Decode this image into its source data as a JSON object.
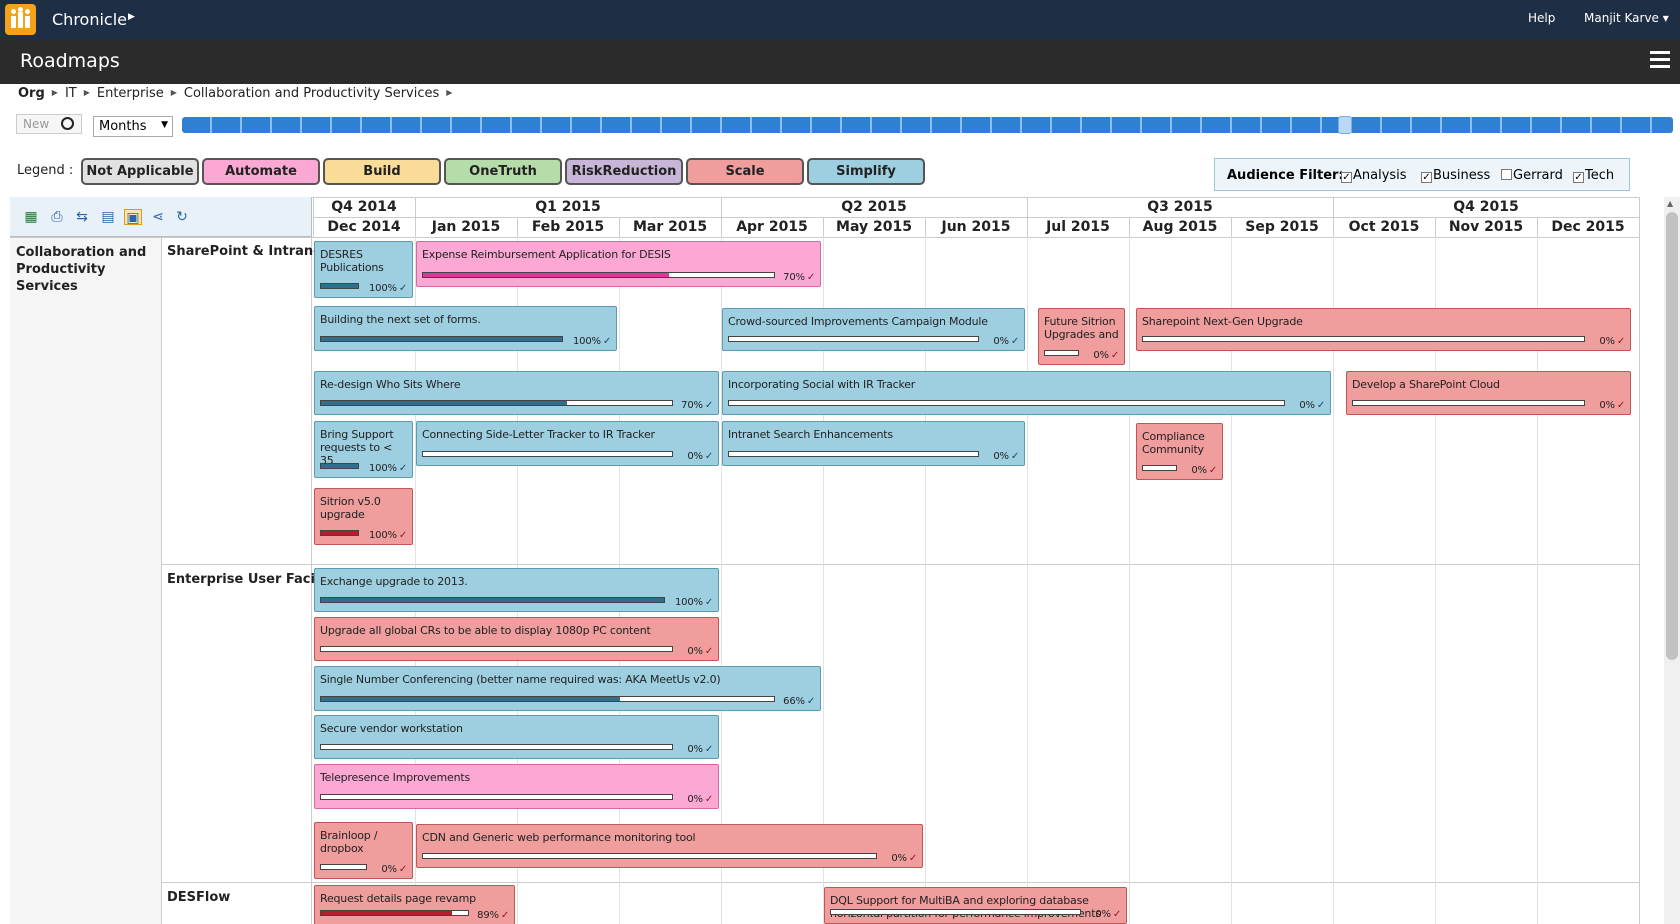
{
  "app": {
    "name": "Chronicle",
    "help": "Help",
    "user": "Manjit Karve ▾"
  },
  "page": {
    "title": "Roadmaps"
  },
  "breadcrumb": [
    "Org",
    "IT",
    "Enterprise",
    "Collaboration and Productivity Services"
  ],
  "toolbar": {
    "new_label": "New",
    "view_mode": "Months"
  },
  "timeline_slider": {
    "position_fraction": 0.79
  },
  "legend": {
    "label": "Legend :",
    "items": [
      {
        "label": "Not Applicable",
        "color": "#e2e2e2"
      },
      {
        "label": "Automate",
        "color": "#fba8d5"
      },
      {
        "label": "Build",
        "color": "#f8dc97"
      },
      {
        "label": "OneTruth",
        "color": "#b5dca9"
      },
      {
        "label": "RiskReduction",
        "color": "#c8b6d9"
      },
      {
        "label": "Scale",
        "color": "#ef9d9d"
      },
      {
        "label": "Simplify",
        "color": "#9dcfe1"
      }
    ]
  },
  "audience_filter": {
    "title": "Audience Filter:",
    "options": [
      {
        "label": "Analysis",
        "checked": true
      },
      {
        "label": "Business",
        "checked": true
      },
      {
        "label": "Gerrard",
        "checked": false
      },
      {
        "label": "Tech",
        "checked": true
      }
    ]
  },
  "grid_tools": [
    "excel-export-icon",
    "print-icon",
    "compare-icon",
    "table-view-icon",
    "roadmap-view-icon",
    "share-icon",
    "refresh-icon"
  ],
  "timeline": {
    "quarters": [
      "Q4 2014",
      "Q1 2015",
      "Q2 2015",
      "Q3 2015",
      "Q4 2015"
    ],
    "months": [
      "Dec 2014",
      "Jan 2015",
      "Feb 2015",
      "Mar 2015",
      "Apr 2015",
      "May 2015",
      "Jun 2015",
      "Jul 2015",
      "Aug 2015",
      "Sep 2015",
      "Oct 2015",
      "Nov 2015",
      "Dec 2015"
    ]
  },
  "org_unit": "Collaboration and Productivity Services",
  "categories": [
    "SharePoint & Intranet",
    "Enterprise User Facing",
    "DESFlow"
  ],
  "projects": [
    {
      "name": "DESRES Publications",
      "theme": "simplify",
      "progress": "100%",
      "start": "Dec 2014",
      "end": "Dec 2014"
    },
    {
      "name": "Expense Reimbursement Application for DESIS",
      "theme": "automate",
      "progress": "70%",
      "start": "Jan 2015",
      "end": "Apr 2015"
    },
    {
      "name": "Building the next set of forms.",
      "theme": "simplify",
      "progress": "100%",
      "start": "Dec 2014",
      "end": "Feb 2015"
    },
    {
      "name": "Crowd-sourced Improvements Campaign Module",
      "theme": "simplify",
      "progress": "0%",
      "start": "Apr 2015",
      "end": "Jun 2015"
    },
    {
      "name": "Future Sitrion Upgrades and",
      "theme": "scale",
      "progress": "0%",
      "start": "Jul 2015",
      "end": "Jul 2015"
    },
    {
      "name": "Sharepoint Next-Gen Upgrade",
      "theme": "scale",
      "progress": "0%",
      "start": "Aug 2015",
      "end": "Dec 2015"
    },
    {
      "name": "Re-design Who Sits Where",
      "theme": "simplify",
      "progress": "70%",
      "start": "Dec 2014",
      "end": "Mar 2015"
    },
    {
      "name": "Incorporating Social with IR Tracker",
      "theme": "simplify",
      "progress": "0%",
      "start": "Apr 2015",
      "end": "Sep 2015"
    },
    {
      "name": "Develop a SharePoint Cloud",
      "theme": "scale",
      "progress": "0%",
      "start": "Oct 2015",
      "end": "Dec 2015"
    },
    {
      "name": "Bring Support requests to < 35",
      "theme": "simplify",
      "progress": "100%",
      "start": "Dec 2014",
      "end": "Dec 2014"
    },
    {
      "name": "Connecting Side-Letter Tracker to IR Tracker",
      "theme": "simplify",
      "progress": "0%",
      "start": "Jan 2015",
      "end": "Mar 2015"
    },
    {
      "name": "Intranet Search Enhancements",
      "theme": "simplify",
      "progress": "0%",
      "start": "Apr 2015",
      "end": "Jun 2015"
    },
    {
      "name": "Compliance Community",
      "theme": "scale",
      "progress": "0%",
      "start": "Aug 2015",
      "end": "Aug 2015"
    },
    {
      "name": "Sitrion v5.0 upgrade",
      "theme": "scale",
      "progress": "100%",
      "start": "Dec 2014",
      "end": "Dec 2014"
    },
    {
      "name": "Exchange upgrade to 2013.",
      "theme": "simplify",
      "progress": "100%",
      "start": "Dec 2014",
      "end": "Mar 2015"
    },
    {
      "name": "Upgrade all global CRs to be able to display 1080p PC content",
      "theme": "scale",
      "progress": "0%",
      "start": "Dec 2014",
      "end": "Mar 2015"
    },
    {
      "name": "Single Number Conferencing (better name required was: AKA MeetUs v2.0)",
      "theme": "simplify",
      "progress": "66%",
      "start": "Dec 2014",
      "end": "Apr 2015"
    },
    {
      "name": "Secure vendor workstation",
      "theme": "simplify",
      "progress": "0%",
      "start": "Dec 2014",
      "end": "Mar 2015"
    },
    {
      "name": "Telepresence Improvements",
      "theme": "automate",
      "progress": "0%",
      "start": "Dec 2014",
      "end": "Mar 2015"
    },
    {
      "name": "Brainloop / dropbox",
      "theme": "scale",
      "progress": "0%",
      "start": "Dec 2014",
      "end": "Dec 2014"
    },
    {
      "name": "CDN and Generic web performance monitoring tool",
      "theme": "scale",
      "progress": "0%",
      "start": "Jan 2015",
      "end": "May 2015"
    },
    {
      "name": "Request details page revamp",
      "theme": "scale",
      "progress": "89%",
      "start": "Dec 2014",
      "end": "Jan 2015"
    },
    {
      "name": "DQL Support for MultiBA and exploring database horizontal partition for performance improvements",
      "theme": "scale",
      "progress": "0%",
      "start": "May 2015",
      "end": "Jul 2015"
    }
  ]
}
